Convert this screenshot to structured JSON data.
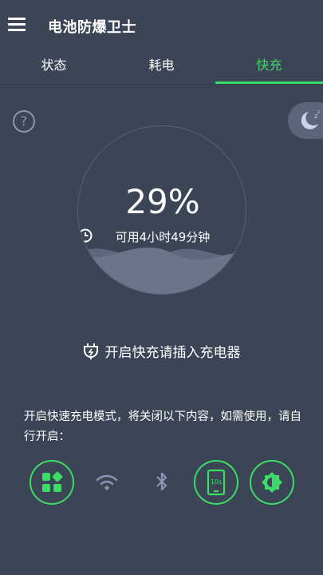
{
  "app": {
    "title": "电池防爆卫士"
  },
  "tabs": [
    {
      "label": "状态",
      "active": false
    },
    {
      "label": "耗电",
      "active": false
    },
    {
      "label": "快充",
      "active": true
    }
  ],
  "help": {
    "label": "?"
  },
  "battery": {
    "percent_text": "29%",
    "level": 0.29,
    "remaining": "可用4小时49分钟"
  },
  "charge_hint": "开启快充请插入充电器",
  "description": "开启快速充电模式，将关闭以下内容，如需使用，请自行开启：",
  "toggles": [
    {
      "icon": "apps-icon",
      "enabled": true
    },
    {
      "icon": "wifi-icon",
      "enabled": false
    },
    {
      "icon": "bluetooth-icon",
      "enabled": false
    },
    {
      "icon": "screen-timeout-icon",
      "label": "10s",
      "enabled": true
    },
    {
      "icon": "brightness-icon",
      "enabled": true
    }
  ],
  "colors": {
    "background": "#3b4556",
    "accent": "#3ddc66",
    "muted_icon": "#8a97b3"
  }
}
